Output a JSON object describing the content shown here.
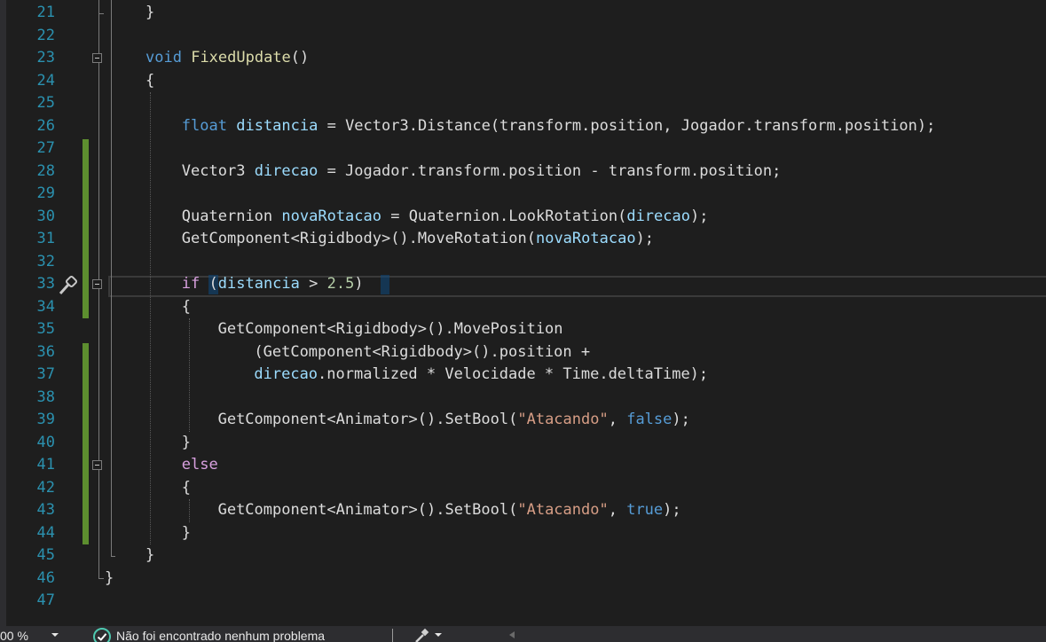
{
  "editor": {
    "lines": [
      {
        "num": "21",
        "indent": 0,
        "tokens": [
          {
            "t": "}",
            "c": ""
          }
        ]
      },
      {
        "num": "22",
        "indent": 0,
        "tokens": []
      },
      {
        "num": "23",
        "indent": 0,
        "tokens": [
          {
            "t": "void",
            "c": "k"
          },
          {
            "t": " ",
            "c": ""
          },
          {
            "t": "FixedUpdate",
            "c": "f"
          },
          {
            "t": "()",
            "c": ""
          }
        ]
      },
      {
        "num": "24",
        "indent": 0,
        "tokens": [
          {
            "t": "{",
            "c": ""
          }
        ]
      },
      {
        "num": "25",
        "indent": 0,
        "tokens": []
      },
      {
        "num": "26",
        "indent": 1,
        "tokens": [
          {
            "t": "float",
            "c": "k"
          },
          {
            "t": " ",
            "c": ""
          },
          {
            "t": "distancia",
            "c": "v"
          },
          {
            "t": " = Vector3.Distance(transform.position, Jogador.transform.position);",
            "c": ""
          }
        ]
      },
      {
        "num": "27",
        "indent": 0,
        "tokens": []
      },
      {
        "num": "28",
        "indent": 1,
        "tokens": [
          {
            "t": "Vector3 ",
            "c": ""
          },
          {
            "t": "direcao",
            "c": "v"
          },
          {
            "t": " = Jogador.transform.position - transform.position;",
            "c": ""
          }
        ]
      },
      {
        "num": "29",
        "indent": 0,
        "tokens": []
      },
      {
        "num": "30",
        "indent": 1,
        "tokens": [
          {
            "t": "Quaternion ",
            "c": ""
          },
          {
            "t": "novaRotacao",
            "c": "v"
          },
          {
            "t": " = Quaternion.LookRotation(",
            "c": ""
          },
          {
            "t": "direcao",
            "c": "v"
          },
          {
            "t": ");",
            "c": ""
          }
        ]
      },
      {
        "num": "31",
        "indent": 1,
        "tokens": [
          {
            "t": "GetComponent<Rigidbody>().MoveRotation(",
            "c": ""
          },
          {
            "t": "novaRotacao",
            "c": "v"
          },
          {
            "t": ");",
            "c": ""
          }
        ]
      },
      {
        "num": "32",
        "indent": 0,
        "tokens": []
      },
      {
        "num": "33",
        "indent": 1,
        "tokens": [
          {
            "t": "if",
            "c": "c"
          },
          {
            "t": " (",
            "c": ""
          },
          {
            "t": "distancia",
            "c": "v"
          },
          {
            "t": " > ",
            "c": ""
          },
          {
            "t": "2.5",
            "c": "n"
          },
          {
            "t": ")",
            "c": ""
          }
        ]
      },
      {
        "num": "34",
        "indent": 1,
        "tokens": [
          {
            "t": "{",
            "c": ""
          }
        ]
      },
      {
        "num": "35",
        "indent": 2,
        "tokens": [
          {
            "t": "GetComponent<Rigidbody>().MovePosition",
            "c": ""
          }
        ]
      },
      {
        "num": "36",
        "indent": 3,
        "tokens": [
          {
            "t": "(GetComponent<Rigidbody>().position +",
            "c": ""
          }
        ]
      },
      {
        "num": "37",
        "indent": 3,
        "tokens": [
          {
            "t": "direcao",
            "c": "v"
          },
          {
            "t": ".normalized * Velocidade * Time.deltaTime);",
            "c": ""
          }
        ]
      },
      {
        "num": "38",
        "indent": 0,
        "tokens": []
      },
      {
        "num": "39",
        "indent": 2,
        "tokens": [
          {
            "t": "GetComponent<Animator>().SetBool(",
            "c": ""
          },
          {
            "t": "\"Atacando\"",
            "c": "s"
          },
          {
            "t": ", ",
            "c": ""
          },
          {
            "t": "false",
            "c": "k"
          },
          {
            "t": ");",
            "c": ""
          }
        ]
      },
      {
        "num": "40",
        "indent": 1,
        "tokens": [
          {
            "t": "}",
            "c": ""
          }
        ]
      },
      {
        "num": "41",
        "indent": 1,
        "tokens": [
          {
            "t": "else",
            "c": "c"
          }
        ]
      },
      {
        "num": "42",
        "indent": 1,
        "tokens": [
          {
            "t": "{",
            "c": ""
          }
        ]
      },
      {
        "num": "43",
        "indent": 2,
        "tokens": [
          {
            "t": "GetComponent<Animator>().SetBool(",
            "c": ""
          },
          {
            "t": "\"Atacando\"",
            "c": "s"
          },
          {
            "t": ", ",
            "c": ""
          },
          {
            "t": "true",
            "c": "k"
          },
          {
            "t": ");",
            "c": ""
          }
        ]
      },
      {
        "num": "44",
        "indent": 1,
        "tokens": [
          {
            "t": "}",
            "c": ""
          }
        ]
      },
      {
        "num": "45",
        "indent": 0,
        "tokens": [
          {
            "t": "}",
            "c": ""
          }
        ]
      },
      {
        "num": "46",
        "indent": -1,
        "tokens": [
          {
            "t": "}",
            "c": ""
          }
        ]
      },
      {
        "num": "47",
        "indent": 0,
        "tokens": []
      }
    ],
    "changed_lines": [
      "27",
      "28",
      "29",
      "30",
      "31",
      "32",
      "33",
      "34",
      "36",
      "37",
      "38",
      "39",
      "40",
      "41",
      "42",
      "43",
      "44"
    ],
    "fold_lines": [
      "23",
      "33",
      "41"
    ],
    "quick_action_line": "33",
    "quick_action_icon": "screwdriver-brush-icon"
  },
  "statusbar": {
    "zoom": "00 %",
    "status_message": "Não foi encontrado nenhum problema",
    "status_icon": "check-circle-icon",
    "cleanup_icon": "code-cleanup-icon"
  },
  "colors": {
    "background": "#1e1e1e",
    "line_number": "#2b91af",
    "keyword": "#569cd6",
    "control_keyword": "#d8a0df",
    "method": "#dcdcaa",
    "local_variable": "#9cdcfe",
    "string": "#d69d85",
    "number": "#b5cea8",
    "plain_text": "#dcdcdc",
    "change_marker": "#5d8e2f"
  }
}
